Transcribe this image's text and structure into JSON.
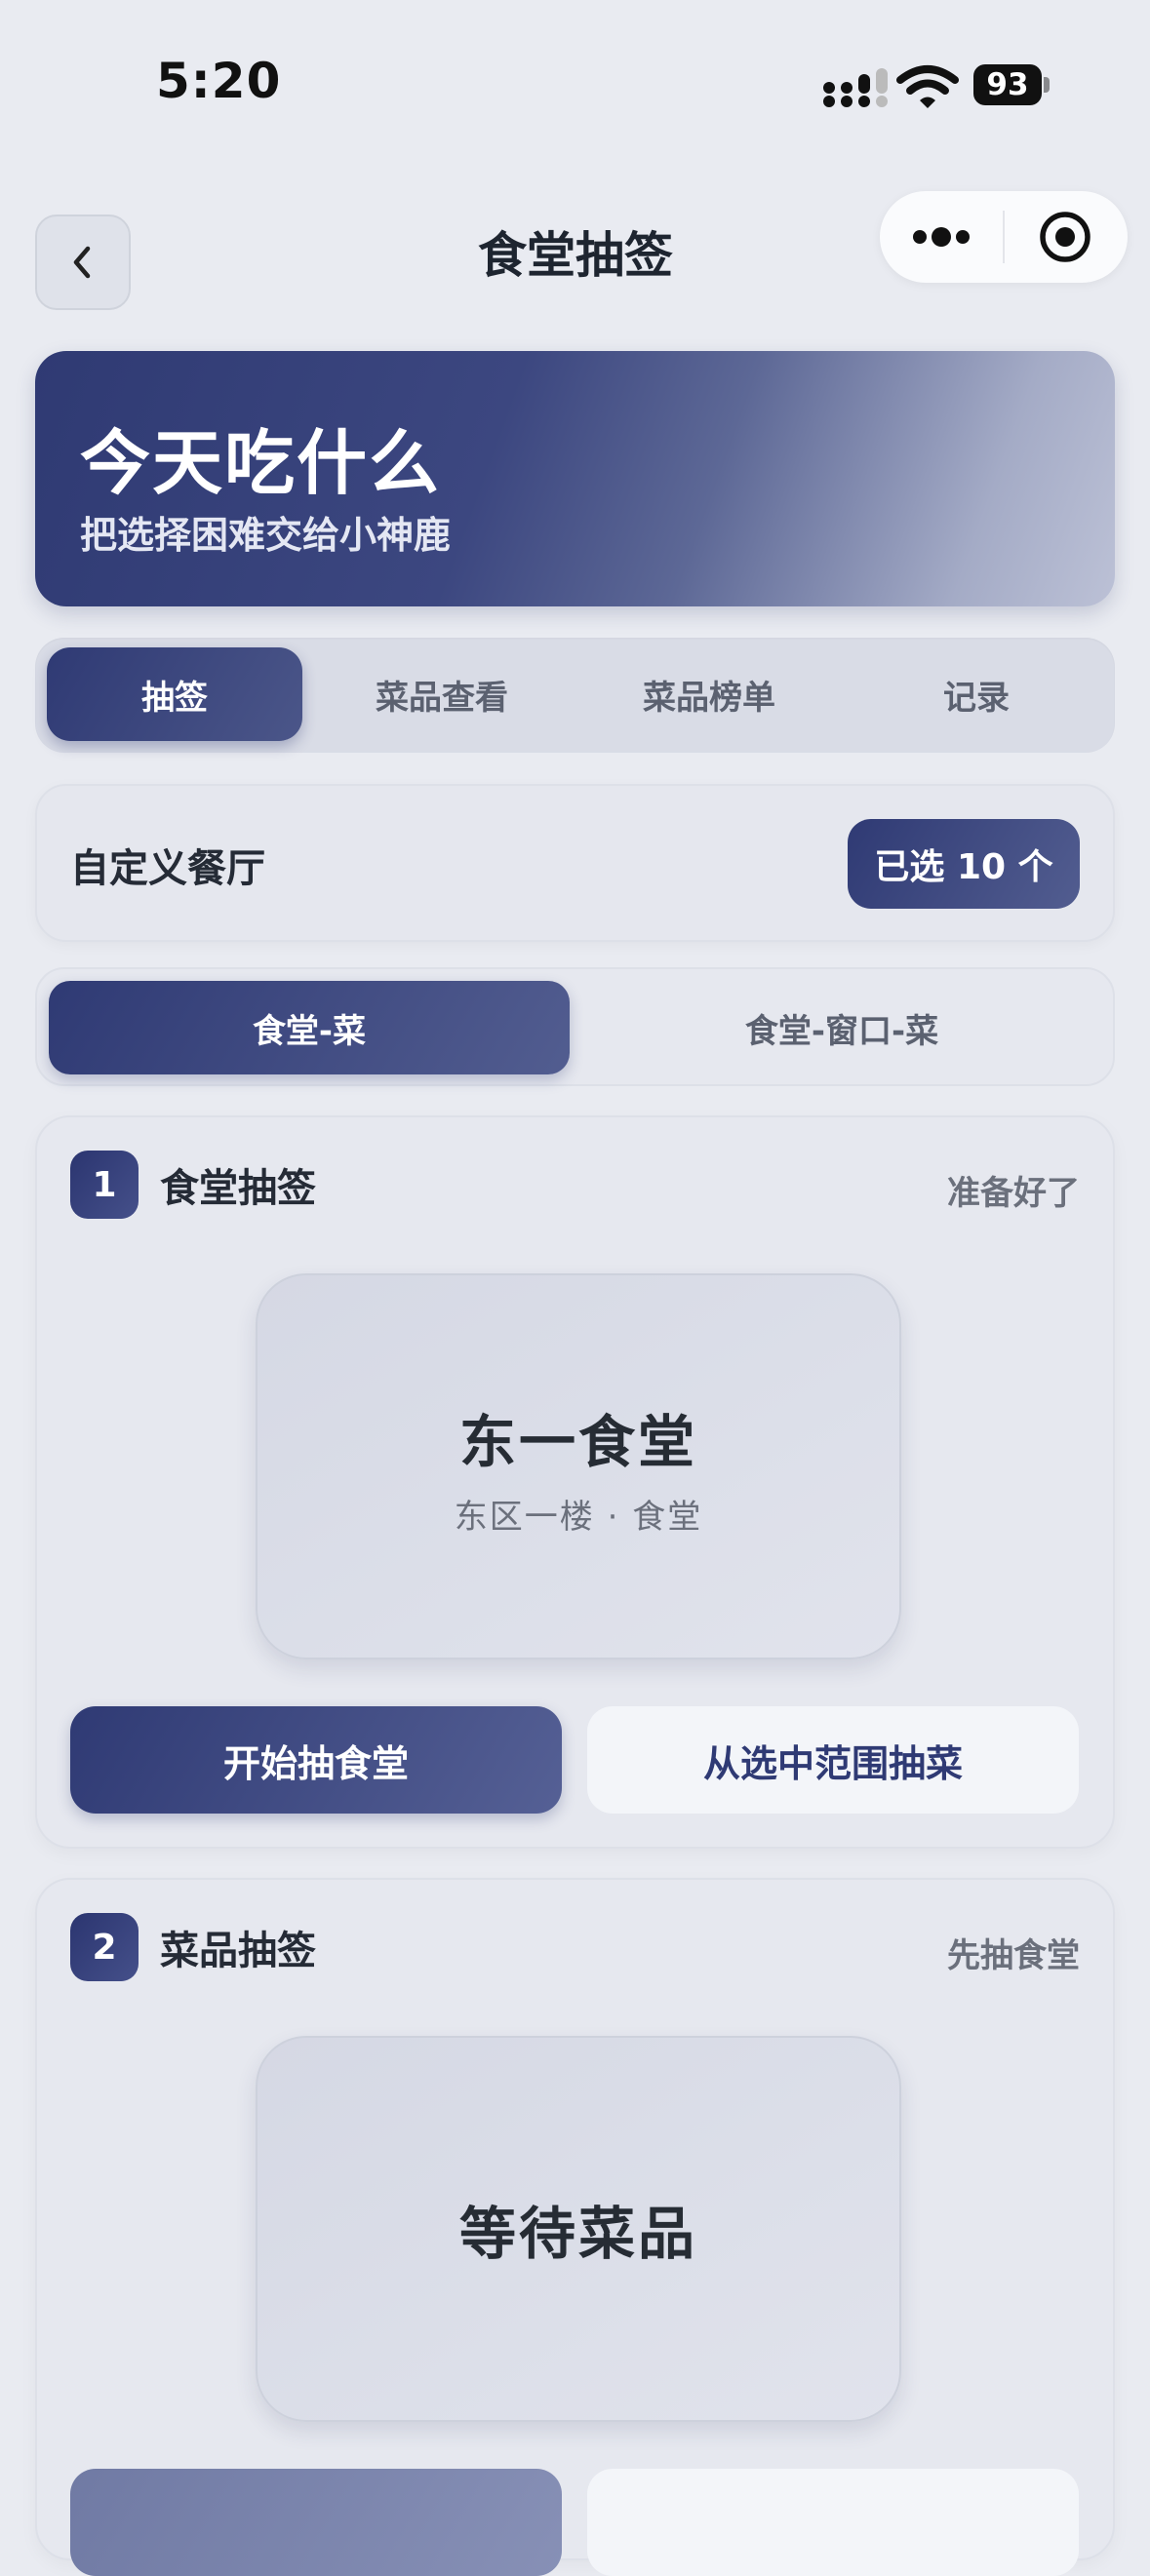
{
  "status_bar": {
    "time": "5:20",
    "battery": "93"
  },
  "nav": {
    "title": "食堂抽签",
    "icons": [
      "chevron-left-icon",
      "more-dots-icon",
      "target-icon"
    ]
  },
  "hero": {
    "title": "今天吃什么",
    "subtitle": "把选择困难交给小神鹿"
  },
  "tabs": [
    {
      "label": "抽签",
      "active": true
    },
    {
      "label": "菜品查看",
      "active": false
    },
    {
      "label": "菜品榜单",
      "active": false
    },
    {
      "label": "记录",
      "active": false
    }
  ],
  "custom_restaurant": {
    "label": "自定义餐厅",
    "selected_button": "已选 10 个"
  },
  "mode": [
    {
      "label": "食堂-菜",
      "active": true
    },
    {
      "label": "食堂-窗口-菜",
      "active": false
    }
  ],
  "card1": {
    "number": "1",
    "title": "食堂抽签",
    "status": "准备好了",
    "result_main": "东一食堂",
    "result_sub": "东区一楼 · 食堂",
    "primary_button": "开始抽食堂",
    "secondary_button": "从选中范围抽菜"
  },
  "card2": {
    "number": "2",
    "title": "菜品抽签",
    "status": "先抽食堂",
    "result_main": "等待菜品"
  },
  "colors": {
    "accent": "#2f3a74",
    "background": "#e9ebf1"
  }
}
